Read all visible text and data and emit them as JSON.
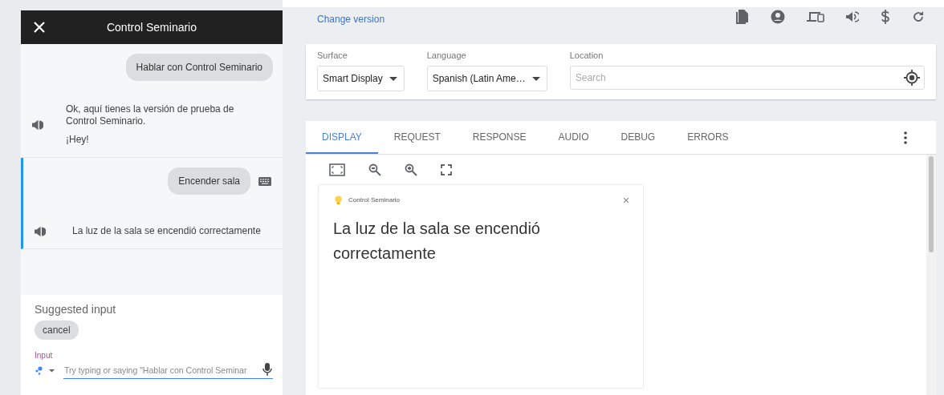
{
  "simulator": {
    "title": "Control Seminario",
    "turns": [
      {
        "user": "Hablar con Control Seminario",
        "typed": false,
        "selected": false,
        "responses": [
          "Ok, aquí tienes la versión de prueba de Control Seminario.",
          "¡Hey!"
        ]
      },
      {
        "user": "Encender sala",
        "typed": true,
        "selected": true,
        "responses": [
          "La luz de la sala se encendió correctamente"
        ]
      }
    ],
    "suggested_label": "Suggested input",
    "suggestions": [
      "cancel"
    ],
    "input": {
      "label": "Input",
      "placeholder": "Try typing or saying \"Hablar con Control Seminar"
    }
  },
  "change_version": "Change version",
  "settings": {
    "surface": {
      "label": "Surface",
      "value": "Smart Display"
    },
    "language": {
      "label": "Language",
      "value": "Spanish (Latin Ame…"
    },
    "location": {
      "label": "Location",
      "placeholder": "Search"
    }
  },
  "tabs": [
    {
      "label": "DISPLAY",
      "selected": true
    },
    {
      "label": "REQUEST",
      "selected": false
    },
    {
      "label": "RESPONSE",
      "selected": false
    },
    {
      "label": "AUDIO",
      "selected": false
    },
    {
      "label": "DEBUG",
      "selected": false
    },
    {
      "label": "ERRORS",
      "selected": false
    }
  ],
  "display_card": {
    "app_name": "Control Seminario",
    "text": "La luz de la sala se encendió correctamente"
  }
}
